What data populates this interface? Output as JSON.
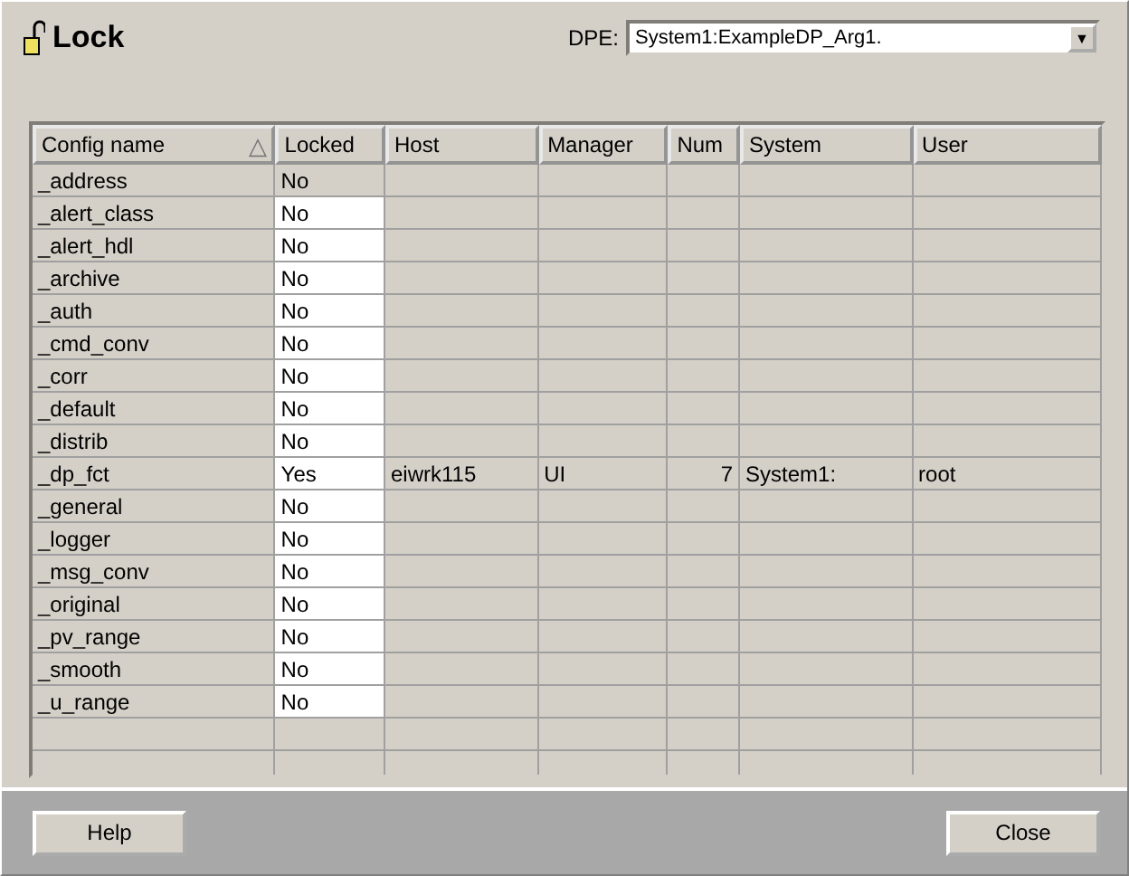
{
  "title": "Lock",
  "dpe": {
    "label": "DPE:",
    "value": "System1:ExampleDP_Arg1.",
    "arrow": "▼"
  },
  "table": {
    "columns": [
      {
        "label": "Config name",
        "sort_icon": "△"
      },
      {
        "label": "Locked"
      },
      {
        "label": "Host"
      },
      {
        "label": "Manager"
      },
      {
        "label": "Num"
      },
      {
        "label": "System"
      },
      {
        "label": "User"
      }
    ],
    "rows": [
      {
        "cells": [
          "_address",
          "No",
          "",
          "",
          "",
          "",
          ""
        ],
        "editable": false
      },
      {
        "cells": [
          "_alert_class",
          "No",
          "",
          "",
          "",
          "",
          ""
        ],
        "editable": true
      },
      {
        "cells": [
          "_alert_hdl",
          "No",
          "",
          "",
          "",
          "",
          ""
        ],
        "editable": true
      },
      {
        "cells": [
          "_archive",
          "No",
          "",
          "",
          "",
          "",
          ""
        ],
        "editable": true
      },
      {
        "cells": [
          "_auth",
          "No",
          "",
          "",
          "",
          "",
          ""
        ],
        "editable": true
      },
      {
        "cells": [
          "_cmd_conv",
          "No",
          "",
          "",
          "",
          "",
          ""
        ],
        "editable": true
      },
      {
        "cells": [
          "_corr",
          "No",
          "",
          "",
          "",
          "",
          ""
        ],
        "editable": true
      },
      {
        "cells": [
          "_default",
          "No",
          "",
          "",
          "",
          "",
          ""
        ],
        "editable": true
      },
      {
        "cells": [
          "_distrib",
          "No",
          "",
          "",
          "",
          "",
          ""
        ],
        "editable": true
      },
      {
        "cells": [
          "_dp_fct",
          "Yes",
          "eiwrk115",
          "UI",
          "7",
          "System1:",
          "root"
        ],
        "editable": true
      },
      {
        "cells": [
          "_general",
          "No",
          "",
          "",
          "",
          "",
          ""
        ],
        "editable": true
      },
      {
        "cells": [
          "_logger",
          "No",
          "",
          "",
          "",
          "",
          ""
        ],
        "editable": true
      },
      {
        "cells": [
          "_msg_conv",
          "No",
          "",
          "",
          "",
          "",
          ""
        ],
        "editable": true
      },
      {
        "cells": [
          "_original",
          "No",
          "",
          "",
          "",
          "",
          ""
        ],
        "editable": true
      },
      {
        "cells": [
          "_pv_range",
          "No",
          "",
          "",
          "",
          "",
          ""
        ],
        "editable": true
      },
      {
        "cells": [
          "_smooth",
          "No",
          "",
          "",
          "",
          "",
          ""
        ],
        "editable": true
      },
      {
        "cells": [
          "_u_range",
          "No",
          "",
          "",
          "",
          "",
          ""
        ],
        "editable": true
      }
    ]
  },
  "buttons": [
    "Help",
    "Close"
  ]
}
